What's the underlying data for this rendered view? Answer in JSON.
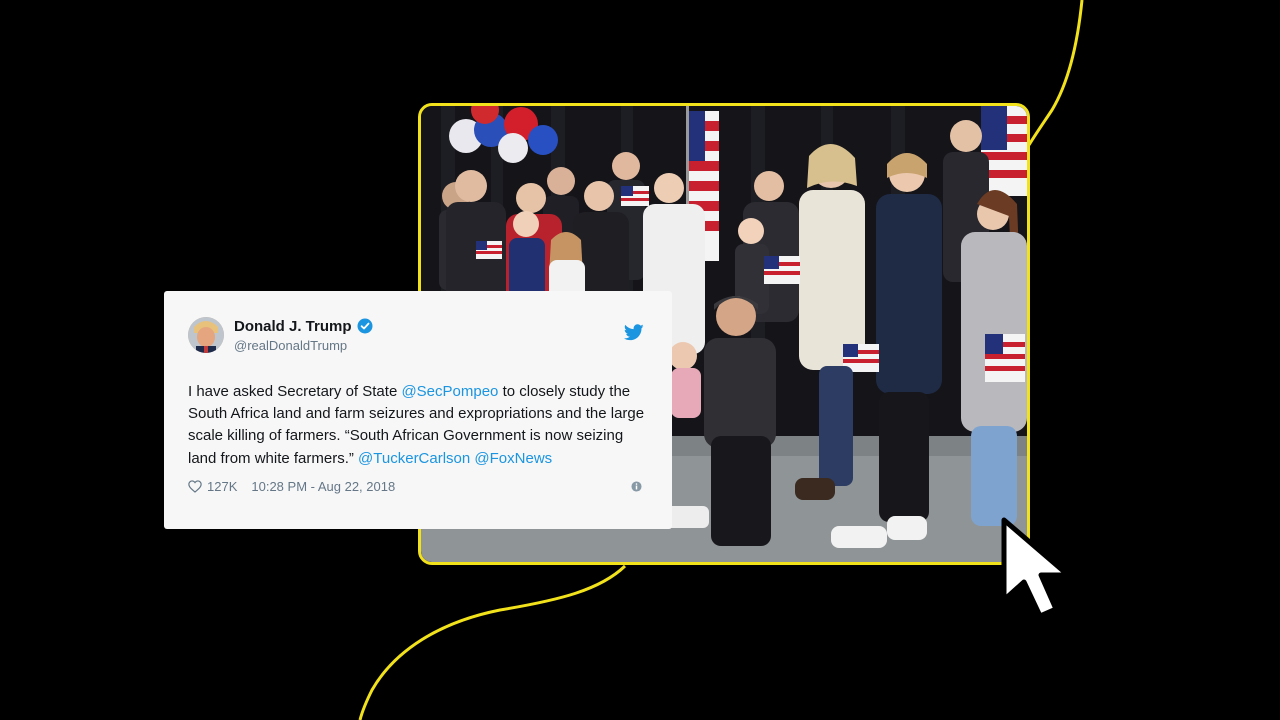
{
  "tweet": {
    "display_name": "Donald J. Trump",
    "handle": "@realDonaldTrump",
    "text_parts": {
      "p1": "I have asked Secretary of State ",
      "m1": "@SecPompeo",
      "p2": " to closely study the South Africa land and farm seizures and expropriations and the large scale killing of farmers. “South African Government is now seizing land from white farmers.” ",
      "m2": "@TuckerCarlson",
      "p3": " ",
      "m3": "@FoxNews"
    },
    "likes": "127K",
    "timestamp": "10:28 PM - Aug 22, 2018"
  },
  "icons": {
    "verified": "verified-badge-icon",
    "twitter": "twitter-bird-icon",
    "like": "heart-icon",
    "info": "info-icon",
    "cursor": "mouse-pointer-icon"
  },
  "colors": {
    "background": "#000000",
    "accent_yellow": "#f2e21c",
    "twitter_blue": "#1b95e0",
    "card_background": "#f7f7f8",
    "muted_text": "#657786"
  }
}
